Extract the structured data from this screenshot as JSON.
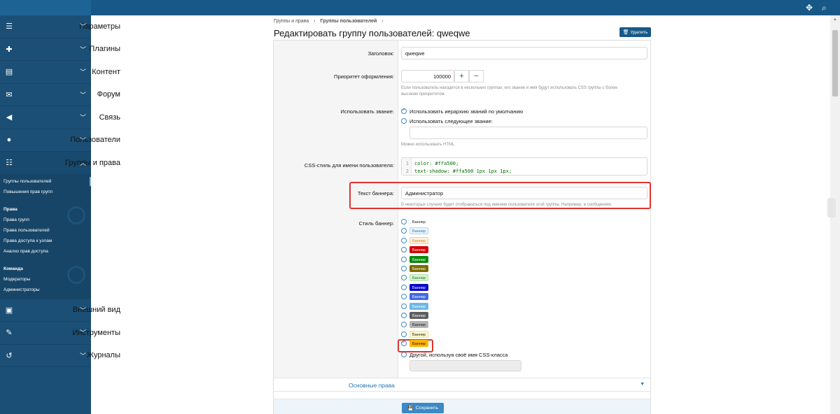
{
  "sidebar": {
    "items_top": [
      {
        "icon": "sliders-icon",
        "glyph": "☰",
        "label": "Параметры"
      },
      {
        "icon": "puzzle-icon",
        "glyph": "✚",
        "label": "Плагины"
      },
      {
        "icon": "content-icon",
        "glyph": "▤",
        "label": "Контент"
      },
      {
        "icon": "forum-icon",
        "glyph": "✉",
        "label": "Форум"
      },
      {
        "icon": "megaphone-icon",
        "glyph": "◀",
        "label": "Связь"
      },
      {
        "icon": "user-icon",
        "glyph": "●",
        "label": "Пользователи"
      },
      {
        "icon": "users-icon",
        "glyph": "☷",
        "label": "Группы и права"
      }
    ],
    "sub_group1": [
      "Группы пользователей",
      "Повышения прав групп"
    ],
    "sub_head_rights": "Права",
    "sub_rights": [
      "Права групп",
      "Права пользователей",
      "Права доступа к узлам",
      "Анализ прав доступа"
    ],
    "sub_head_team": "Команда",
    "sub_team": [
      "Модераторы",
      "Администраторы"
    ],
    "items_bottom": [
      {
        "icon": "appearance-icon",
        "glyph": "▣",
        "label": "Внешний вид"
      },
      {
        "icon": "wrench-icon",
        "glyph": "✎",
        "label": "Инструменты"
      },
      {
        "icon": "history-icon",
        "glyph": "↺",
        "label": "Журналы"
      }
    ]
  },
  "breadcrumb": {
    "first": "Группы и права",
    "second": "Группы пользователей"
  },
  "page_title": "Редактировать группу пользователей: qweqwe",
  "delete_label": "Удалить",
  "form": {
    "title_label": "Заголовок:",
    "title_value": "qweqwe",
    "priority_label": "Приоритет оформления:",
    "priority_value": "100000",
    "priority_hint_1": "Если пользователь находится в нескольких группах, его звание и имя будут использовать CSS группы с более",
    "priority_hint_2": "высоким приоритетом.",
    "rank_label": "Использовать звание:",
    "rank_opt1": "Использовать иерархию званий по умолчанию",
    "rank_opt2": "Использовать следующее звание:",
    "rank_hint": "Можно использовать HTML",
    "css_label": "CSS-стиль для имени пользователя:",
    "css_line1": "color: #ffa500;",
    "css_line2": "text-shadow: #ffa500 1px 1px 1px;",
    "banner_text_label": "Текст баннера:",
    "banner_text_value": "Администратор",
    "banner_text_hint": "В некоторых случаях будет отображаться под именем пользователя этой группы. Например, в сообщениях.",
    "banner_style_label": "Стиль баннер:",
    "banner_word": "Баннер",
    "banner_other": "Другой, используя своё имя CSS-класса"
  },
  "banner_styles": [
    {
      "bg": "#ffffff",
      "fg": "#141414",
      "border": "#ffffff"
    },
    {
      "bg": "#e8f4fb",
      "fg": "#2577b1",
      "border": "#b8d5ea"
    },
    {
      "bg": "#fff1e0",
      "fg": "#e07a00",
      "border": "#f5c991"
    },
    {
      "bg": "#d40000",
      "fg": "#ffffff",
      "border": "#d40000"
    },
    {
      "bg": "#0a8a0a",
      "fg": "#ffffff",
      "border": "#0a8a0a"
    },
    {
      "bg": "#7c6a00",
      "fg": "#ffffff",
      "border": "#7c6a00"
    },
    {
      "bg": "#d6f3d0",
      "fg": "#1c7a1c",
      "border": "#b8e0b0"
    },
    {
      "bg": "#0a0ac8",
      "fg": "#ffffff",
      "border": "#0a0ac8"
    },
    {
      "bg": "#4169e1",
      "fg": "#ffffff",
      "border": "#4169e1"
    },
    {
      "bg": "#6fb7e4",
      "fg": "#ffffff",
      "border": "#6fb7e4"
    },
    {
      "bg": "#5e5e5e",
      "fg": "#ffffff",
      "border": "#5e5e5e"
    },
    {
      "bg": "#b4b4b4",
      "fg": "#141414",
      "border": "#b4b4b4"
    },
    {
      "bg": "#fff8cc",
      "fg": "#141414",
      "border": "#f0e08a"
    },
    {
      "bg": "#ffb400",
      "fg": "#141414",
      "border": "#ffb400"
    }
  ],
  "section_basic_rights": "Основные права",
  "save_label": "Сохранить",
  "colors": {
    "topbar": "#185886",
    "sidebar": "#1b4f75",
    "accent": "#3b89c6",
    "highlight": "#e0342f"
  }
}
